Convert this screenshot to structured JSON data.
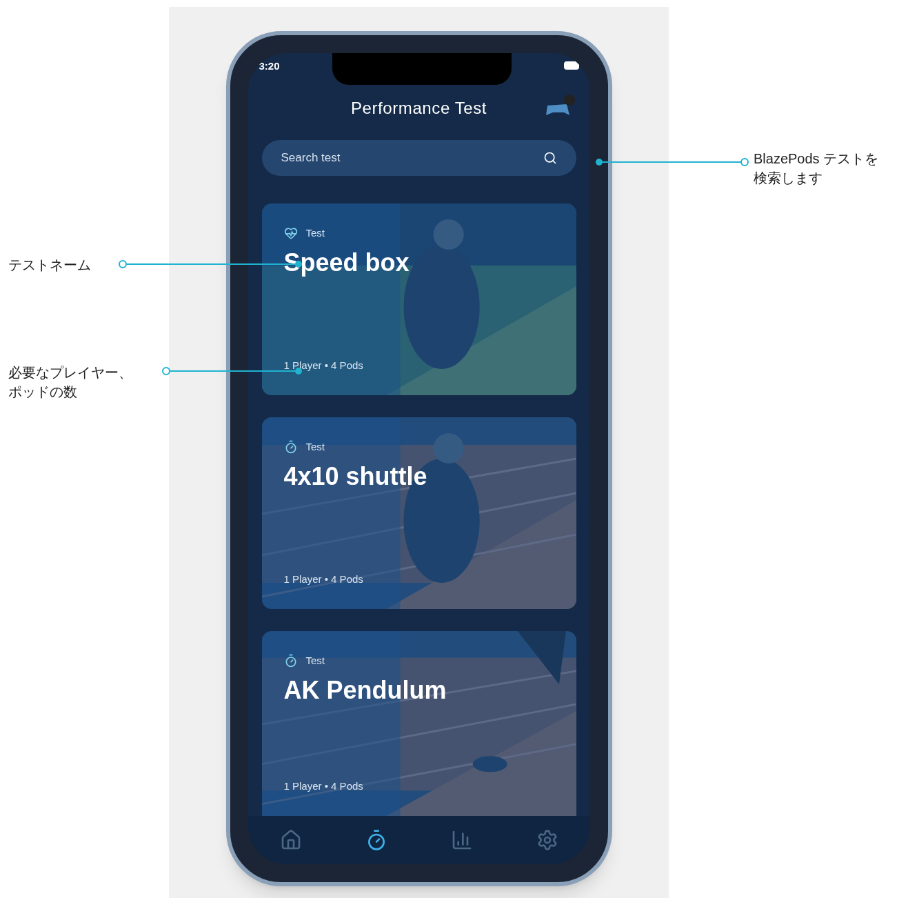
{
  "status_bar": {
    "time": "3:20"
  },
  "header": {
    "title": "Performance Test"
  },
  "search": {
    "placeholder": "Search test"
  },
  "cards": [
    {
      "kind": "heart",
      "tag": "Test",
      "title": "Speed box",
      "meta": "1 Player • 4 Pods"
    },
    {
      "kind": "timer",
      "tag": "Test",
      "title": "4x10 shuttle",
      "meta": "1 Player • 4 Pods"
    },
    {
      "kind": "timer",
      "tag": "Test",
      "title": "AK Pendulum",
      "meta": "1 Player • 4 Pods"
    }
  ],
  "nav": [
    {
      "kind": "home",
      "selected": false
    },
    {
      "kind": "timer",
      "selected": true
    },
    {
      "kind": "stats",
      "selected": false
    },
    {
      "kind": "settings",
      "selected": false
    }
  ],
  "annotations": [
    {
      "text": "BlazePods テストを検索します"
    },
    {
      "text": "テストネーム"
    },
    {
      "text": "必要なプレイヤー、ポッドの数"
    }
  ]
}
